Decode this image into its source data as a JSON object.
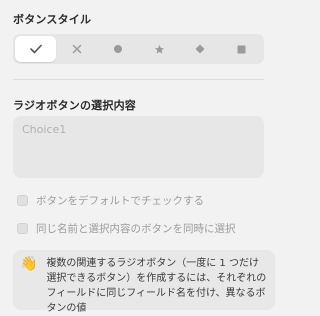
{
  "button_style": {
    "title": "ボタンスタイル",
    "options": [
      {
        "icon": "check-icon",
        "selected": true
      },
      {
        "icon": "cross-icon",
        "selected": false
      },
      {
        "icon": "circle-icon",
        "selected": false
      },
      {
        "icon": "star-icon",
        "selected": false
      },
      {
        "icon": "diamond-icon",
        "selected": false
      },
      {
        "icon": "square-icon",
        "selected": false
      }
    ]
  },
  "choice": {
    "title": "ラジオボタンの選択内容",
    "placeholder": "Choice1"
  },
  "checkboxes": {
    "default_checked": "ボタンをデフォルトでチェックする",
    "same_name_select": "同じ名前と選択内容のボタンを同時に選択"
  },
  "info": {
    "icon": "👋",
    "text": "複数の関連するラジオボタン（一度に 1 つだけ選択できるボタン）を作成するには、それぞれのフィールドに同じフィールド名を付け、異なるボタンの値"
  },
  "colors": {
    "background": "#f2f2f2",
    "segment_bg": "#e6e6e6",
    "icon_gray": "#9a9a9a",
    "icon_dark": "#555555"
  }
}
